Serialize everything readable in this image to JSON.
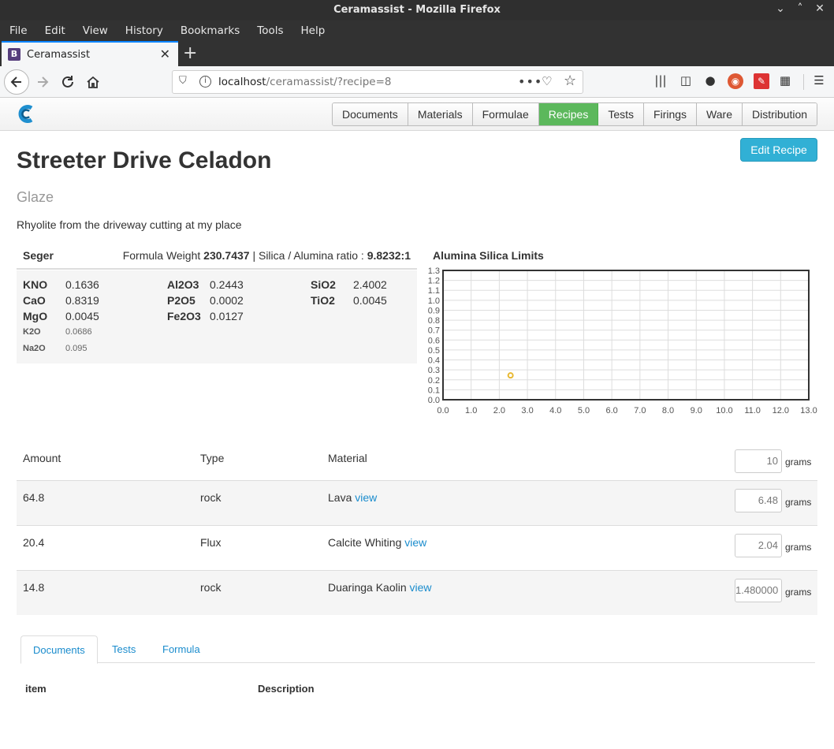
{
  "window": {
    "title": "Ceramassist - Mozilla Firefox"
  },
  "menu": [
    "File",
    "Edit",
    "View",
    "History",
    "Bookmarks",
    "Tools",
    "Help"
  ],
  "tab": {
    "title": "Ceramassist",
    "favicon": "B"
  },
  "url": {
    "host": "localhost",
    "path": "/ceramassist/?recipe=8"
  },
  "appnav": [
    "Documents",
    "Materials",
    "Formulae",
    "Recipes",
    "Tests",
    "Firings",
    "Ware",
    "Distribution"
  ],
  "appnav_active": "Recipes",
  "recipe": {
    "title": "Streeter Drive Celadon",
    "type": "Glaze",
    "description": "Rhyolite from the driveway cutting at my place",
    "edit_label": "Edit Recipe"
  },
  "seger": {
    "label": "Seger",
    "fw_label": "Formula Weight",
    "fw_value": "230.7437",
    "ratio_label": "| Silica / Alumina ratio :",
    "ratio_value": "9.8232:1",
    "col1": [
      {
        "name": "KNO",
        "value": "0.1636",
        "small": false
      },
      {
        "name": "CaO",
        "value": "0.8319",
        "small": false
      },
      {
        "name": "MgO",
        "value": "0.0045",
        "small": false
      },
      {
        "name": "K2O",
        "value": "0.0686",
        "small": true
      },
      {
        "name": "Na2O",
        "value": "0.095",
        "small": true
      }
    ],
    "col2": [
      {
        "name": "Al2O3",
        "value": "0.2443"
      },
      {
        "name": "P2O5",
        "value": "0.0002"
      },
      {
        "name": "Fe2O3",
        "value": "0.0127"
      }
    ],
    "col3": [
      {
        "name": "SiO2",
        "value": "2.4002"
      },
      {
        "name": "TiO2",
        "value": "0.0045"
      }
    ]
  },
  "chart_data": {
    "type": "scatter",
    "title": "Alumina Silica Limits",
    "xlabel": "",
    "ylabel": "",
    "xlim": [
      0,
      13
    ],
    "ylim": [
      0,
      1.3
    ],
    "x_ticks": [
      "0.0",
      "1.0",
      "2.0",
      "3.0",
      "4.0",
      "5.0",
      "6.0",
      "7.0",
      "8.0",
      "9.0",
      "10.0",
      "11.0",
      "12.0",
      "13.0"
    ],
    "y_ticks": [
      "0.0",
      "0.1",
      "0.2",
      "0.3",
      "0.4",
      "0.5",
      "0.6",
      "0.7",
      "0.8",
      "0.9",
      "1.0",
      "1.1",
      "1.2",
      "1.3"
    ],
    "grid": true,
    "points": [
      {
        "x": 2.4002,
        "y": 0.2443
      }
    ],
    "point_color": "#e8b830"
  },
  "materials": {
    "headers": {
      "amount": "Amount",
      "type": "Type",
      "material": "Material",
      "grams_value": "10",
      "grams_unit": "grams"
    },
    "view_label": "view",
    "rows": [
      {
        "amount": "64.8",
        "type": "rock",
        "material": "Lava",
        "grams": "6.48"
      },
      {
        "amount": "20.4",
        "type": "Flux",
        "material": "Calcite Whiting",
        "grams": "2.04"
      },
      {
        "amount": "14.8",
        "type": "rock",
        "material": "Duaringa Kaolin",
        "grams": "1.480000"
      }
    ]
  },
  "bottom_tabs": [
    "Documents",
    "Tests",
    "Formula"
  ],
  "bottom_table": {
    "col1": "item",
    "col2": "Description"
  },
  "colors": {
    "active_nav": "#5cb85c",
    "edit_button": "#31b0d5",
    "link": "#1a8ccd"
  }
}
